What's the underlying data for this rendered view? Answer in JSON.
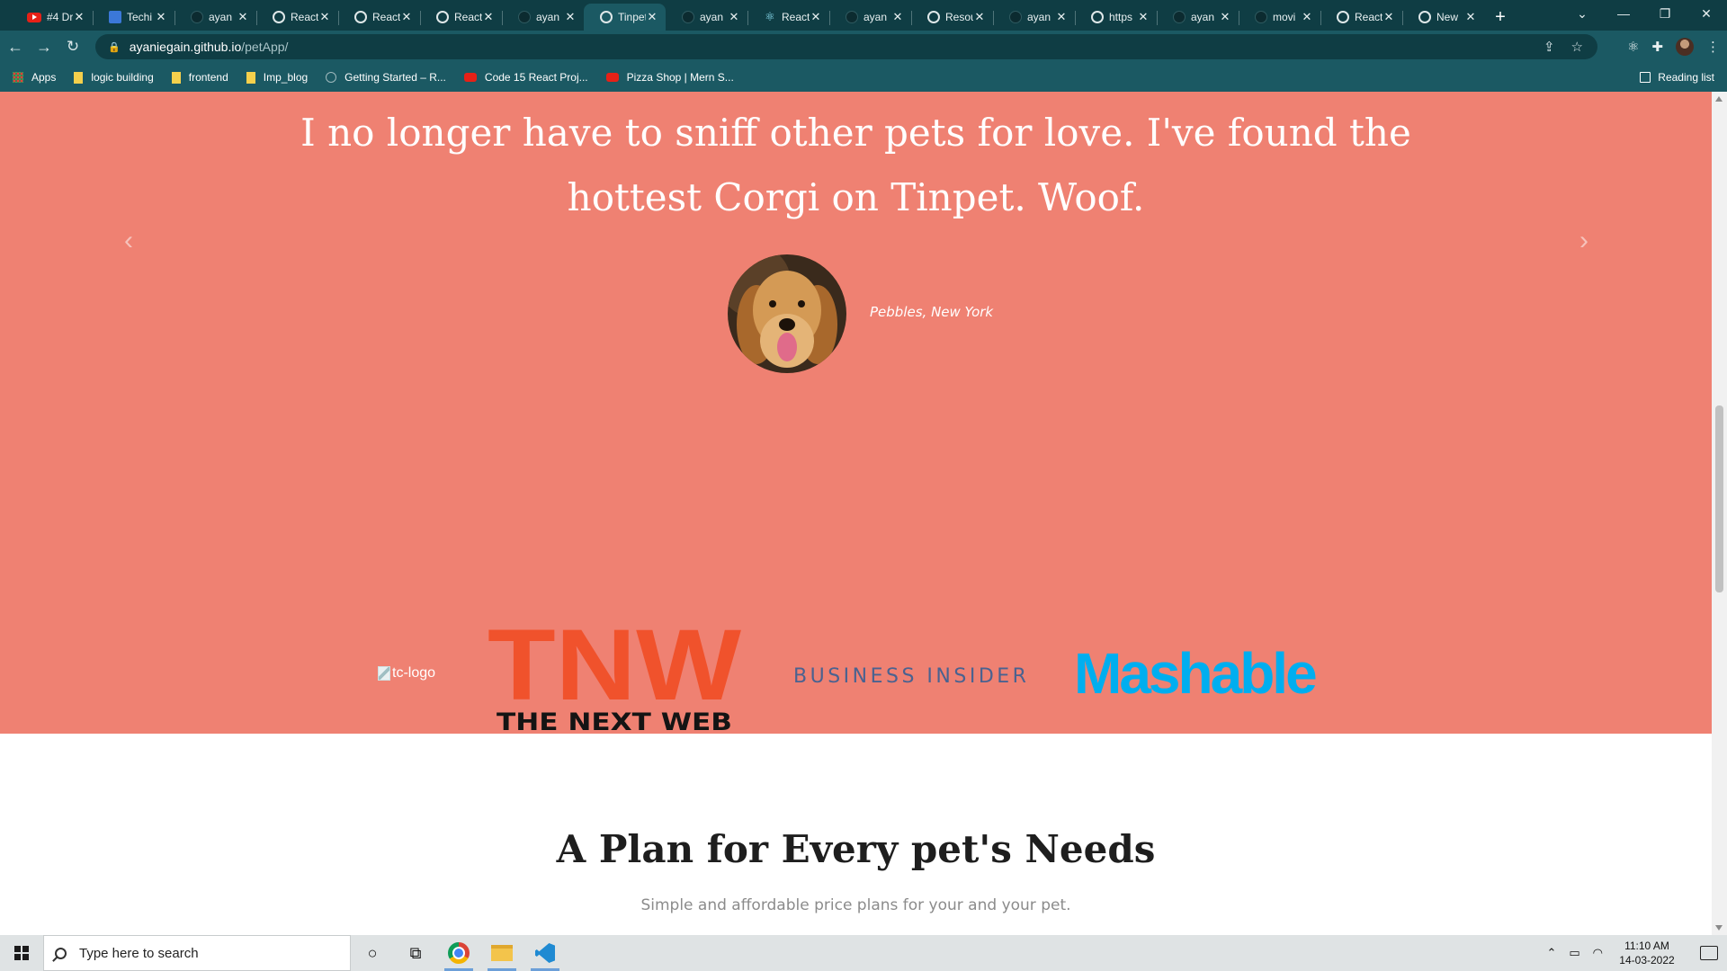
{
  "browser": {
    "tabs": [
      {
        "label": "#4 Dr",
        "icon": "youtube-icon"
      },
      {
        "label": "Techi",
        "icon": "tech-icon"
      },
      {
        "label": "ayan",
        "icon": "github-icon"
      },
      {
        "label": "React",
        "icon": "globe-icon"
      },
      {
        "label": "React",
        "icon": "globe-icon"
      },
      {
        "label": "React",
        "icon": "globe-icon"
      },
      {
        "label": "ayan",
        "icon": "github-icon"
      },
      {
        "label": "Tinpet",
        "icon": "globe-icon",
        "active": true
      },
      {
        "label": "ayan",
        "icon": "github-icon"
      },
      {
        "label": "React",
        "icon": "react-icon"
      },
      {
        "label": "ayan",
        "icon": "github-icon"
      },
      {
        "label": "Resou",
        "icon": "globe-icon"
      },
      {
        "label": "ayan",
        "icon": "github-icon"
      },
      {
        "label": "https",
        "icon": "globe-icon"
      },
      {
        "label": "ayan",
        "icon": "github-icon"
      },
      {
        "label": "movi",
        "icon": "github-icon"
      },
      {
        "label": "React",
        "icon": "globe-icon"
      },
      {
        "label": "New",
        "icon": "globe-icon"
      }
    ],
    "url_host": "ayaniegain.github.io",
    "url_path": "/petApp/",
    "bookmarks": [
      {
        "label": "Apps",
        "icon": "apps-icon"
      },
      {
        "label": "logic building",
        "icon": "folder-icon"
      },
      {
        "label": "frontend",
        "icon": "folder-icon"
      },
      {
        "label": "Imp_blog",
        "icon": "folder-icon"
      },
      {
        "label": "Getting Started – R...",
        "icon": "react-icon"
      },
      {
        "label": "Code 15 React Proj...",
        "icon": "youtube-icon"
      },
      {
        "label": "Pizza Shop | Mern S...",
        "icon": "youtube-icon"
      }
    ],
    "reading_list": "Reading list"
  },
  "page": {
    "testimonial": {
      "quote": "I no longer have to sniff other pets for love. I've found the hottest Corgi on Tinpet. Woof.",
      "author": "Pebbles, New York"
    },
    "press": {
      "tc_alt": "tc-logo",
      "tnw_top": "TNW",
      "tnw_bottom": "THE NEXT WEB",
      "business_insider": "BUSINESS INSIDER",
      "mashable": "Mashable"
    },
    "pricing": {
      "title": "A Plan for Every pet's Needs",
      "subtitle": "Simple and affordable price plans for your and your pet."
    }
  },
  "taskbar": {
    "search_placeholder": "Type here to search",
    "time": "11:10 AM",
    "date": "14-03-2022"
  },
  "colors": {
    "accent": "#ef8172",
    "chrome": "#1b5963",
    "tnw": "#f0522c",
    "mashable": "#00aeef"
  }
}
